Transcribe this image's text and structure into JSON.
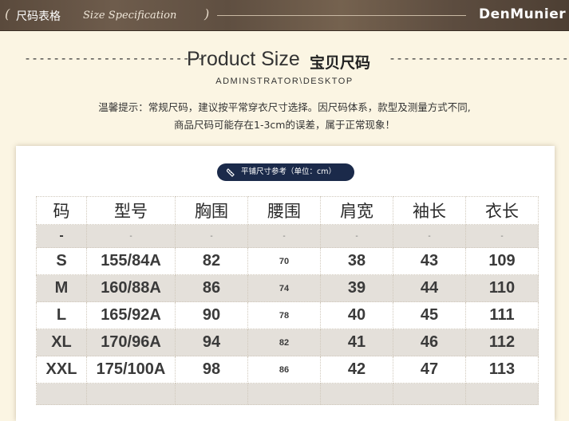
{
  "header": {
    "title_cn": "尺码表格",
    "title_en": "Size Specification",
    "open_paren": "(",
    "close_paren": ")",
    "brand": "DenMunier"
  },
  "heading": {
    "dashes": "-------------------------",
    "title_en": "Product Size",
    "title_cn": "宝贝尺码",
    "path": "ADMINSTRATOR\\DESKTOP"
  },
  "tips": {
    "line1": "温馨提示：常规尺码，建议按平常穿衣尺寸选择。因尺码体系，款型及测量方式不同,",
    "line2": "商品尺码可能存在1-3cm的误差，属于正常现象！"
  },
  "badge": {
    "label": "平铺尺寸参考（单位：cm）",
    "icon": "ruler-icon"
  },
  "table": {
    "headers": [
      "码",
      "型号",
      "胸围",
      "腰围",
      "肩宽",
      "袖长",
      "衣长"
    ],
    "dash_row": [
      "-",
      "-",
      "-",
      "-",
      "-",
      "-",
      "-"
    ],
    "rows": [
      [
        "S",
        "155/84A",
        "82",
        "70",
        "38",
        "43",
        "109"
      ],
      [
        "M",
        "160/88A",
        "86",
        "74",
        "39",
        "44",
        "110"
      ],
      [
        "L",
        "165/92A",
        "90",
        "78",
        "40",
        "45",
        "111"
      ],
      [
        "XL",
        "170/96A",
        "94",
        "82",
        "41",
        "46",
        "112"
      ],
      [
        "XXL",
        "175/100A",
        "98",
        "86",
        "42",
        "47",
        "113"
      ]
    ]
  },
  "colors": {
    "header_bar": "#5f4f41",
    "page_bg": "#fbf5e3",
    "badge_bg": "#1b2a4a",
    "row_stripe": "#e4e0da"
  }
}
